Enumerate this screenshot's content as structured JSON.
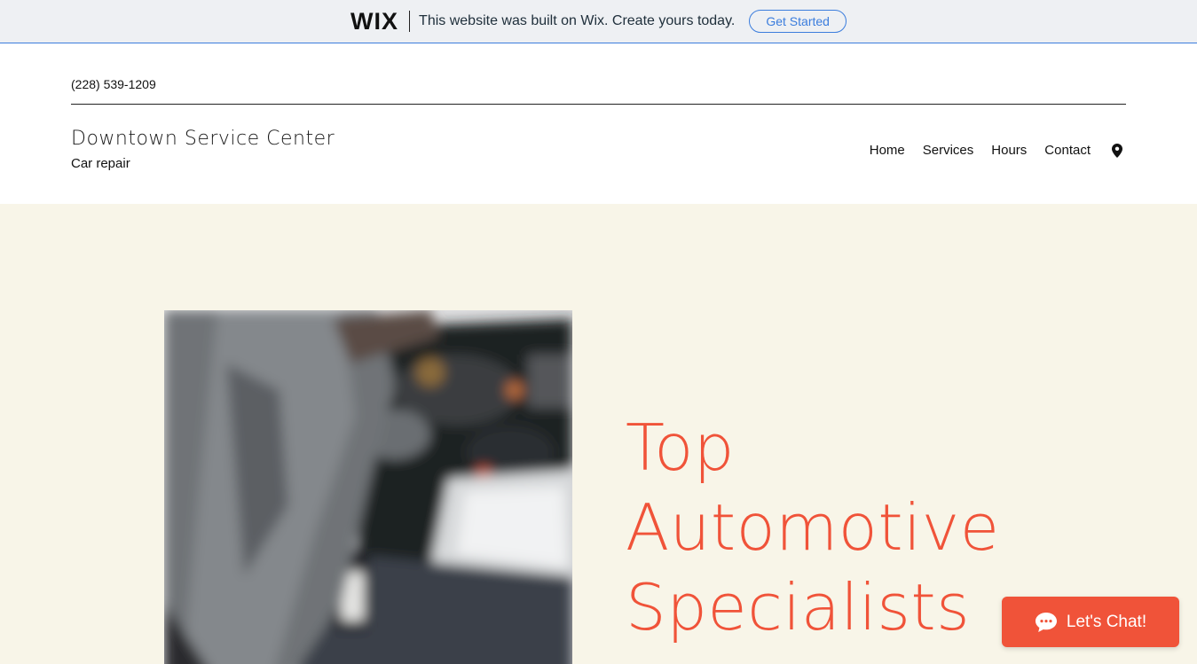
{
  "wix_banner": {
    "logo": "WIX",
    "message": "This website was built on Wix. Create yours today.",
    "cta_label": "Get Started",
    "accent": "#3b7ddd"
  },
  "header": {
    "phone": "(228) 539-1209",
    "site_title": "Downtown Service Center",
    "site_subtitle": "Car repair",
    "nav": [
      "Home",
      "Services",
      "Hours",
      "Contact"
    ],
    "location_icon": "map-pin-icon"
  },
  "hero": {
    "title_lines": [
      "Top",
      "Automotive",
      "Specialists"
    ],
    "background": "#f8f5e8",
    "title_color": "#f05339",
    "image_subject": "mechanic working under car hood"
  },
  "chat": {
    "label": "Let's Chat!",
    "icon": "chat-bubble-icon",
    "color": "#f05339"
  }
}
